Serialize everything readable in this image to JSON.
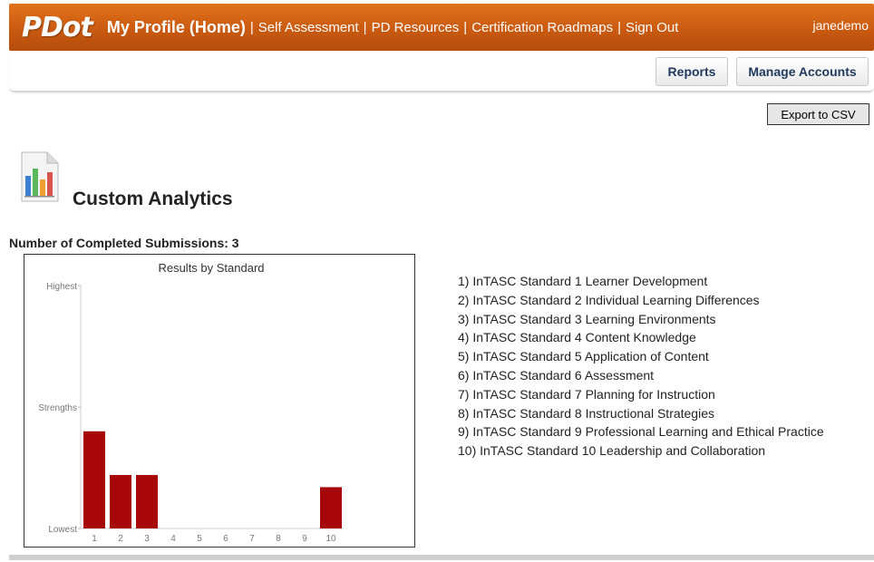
{
  "app": {
    "logo": "PDot",
    "user": "janedemo"
  },
  "nav": {
    "home": "My Profile (Home)",
    "separator": "|",
    "links": [
      "Self Assessment",
      "PD Resources",
      "Certification Roadmaps",
      "Sign Out"
    ]
  },
  "toolbar": {
    "reports_label": "Reports",
    "manage_label": "Manage Accounts",
    "export_label": "Export to CSV"
  },
  "page": {
    "title": "Custom Analytics",
    "icon": "bar-chart-document-icon",
    "submissions_label": "Number of Completed Submissions: 3"
  },
  "standards": [
    "1) InTASC Standard 1 Learner Development",
    "2) InTASC Standard 2 Individual Learning Differences",
    "3) InTASC Standard 3 Learning Environments",
    "4) InTASC Standard 4 Content Knowledge",
    "5) InTASC Standard 5 Application of Content",
    "6) InTASC Standard 6 Assessment",
    "7) InTASC Standard 7 Planning for Instruction",
    "8) InTASC Standard 8 Instructional Strategies",
    "9) InTASC Standard 9 Professional Learning and Ethical Practice",
    "10) InTASC Standard 10 Leadership and Collaboration"
  ],
  "colors": {
    "brand_orange": "#d0620f",
    "bar_red": "#a8070a"
  },
  "chart_data": {
    "type": "bar",
    "title": "Results by Standard",
    "categories": [
      "1",
      "2",
      "3",
      "4",
      "5",
      "6",
      "7",
      "8",
      "9",
      "10"
    ],
    "values": [
      0.4,
      0.22,
      0.22,
      0,
      0,
      0,
      0,
      0,
      0,
      0.17
    ],
    "ylim": [
      0,
      1
    ],
    "y_tick_labels": [
      "Lowest",
      "Strengths",
      "Highest"
    ],
    "y_tick_positions": [
      0,
      0.5,
      1
    ],
    "xlabel": "",
    "ylabel": "",
    "grid": false
  }
}
